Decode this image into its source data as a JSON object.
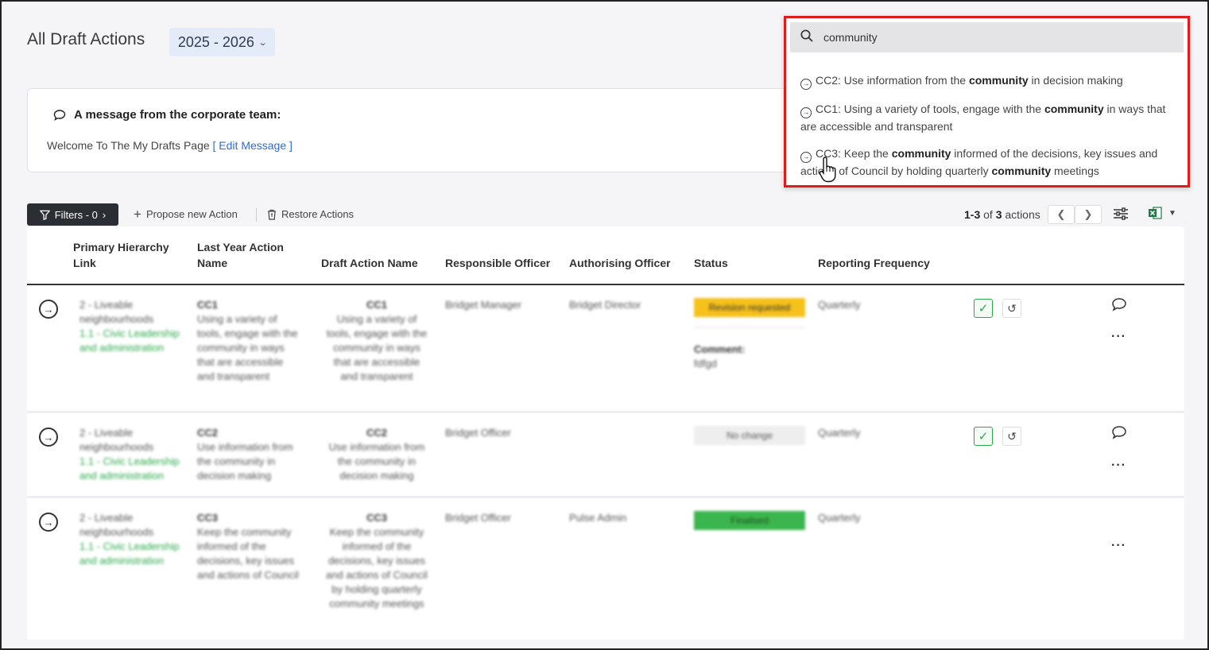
{
  "header": {
    "title": "All Draft Actions",
    "year": "2025 - 2026"
  },
  "message": {
    "title": "A message from the corporate team:",
    "body": "Welcome To The My Drafts Page",
    "edit_link": "[ Edit Message ]"
  },
  "toolbar": {
    "filters": "Filters - 0",
    "propose": "Propose new Action",
    "restore": "Restore Actions",
    "count_range": "1-3",
    "count_of": "of",
    "count_total": "3",
    "count_suffix": "actions"
  },
  "table": {
    "headers": {
      "primary": "Primary Hierarchy Link",
      "last_year": "Last Year Action Name",
      "draft": "Draft Action Name",
      "responsible": "Responsible Officer",
      "authorising": "Authorising Officer",
      "status": "Status",
      "frequency": "Reporting Frequency"
    },
    "rows": [
      {
        "hier1": "2 - Liveable neighbourhoods",
        "hier2": "1.1 - Civic Leadership and administration",
        "ly_code": "CC1",
        "ly_text": "Using a variety of tools, engage with the community in ways that are accessible and transparent",
        "d_code": "CC1",
        "d_text": "Using a variety of tools, engage with the community in ways that are accessible and transparent",
        "responsible": "Bridget Manager",
        "authorising": "Bridget Director",
        "status": "Revision requested",
        "comment_label": "Comment:",
        "comment": "fdfgd",
        "frequency": "Quarterly"
      },
      {
        "hier1": "2 - Liveable neighbourhoods",
        "hier2": "1.1 - Civic Leadership and administration",
        "ly_code": "CC2",
        "ly_text": "Use information from the community in decision making",
        "d_code": "CC2",
        "d_text": "Use information from the community in decision making",
        "responsible": "Bridget Officer",
        "authorising": "",
        "status": "No change",
        "frequency": "Quarterly"
      },
      {
        "hier1": "2 - Liveable neighbourhoods",
        "hier2": "1.1 - Civic Leadership and administration",
        "ly_code": "CC3",
        "ly_text": "Keep the community informed of the decisions, key issues and actions of Council",
        "d_code": "CC3",
        "d_text": "Keep the community informed of the decisions, key issues and actions of Council by holding quarterly community meetings",
        "responsible": "Bridget Officer",
        "authorising": "Pulse Admin",
        "status": "Finalised",
        "frequency": "Quarterly"
      }
    ]
  },
  "search": {
    "value": "community",
    "suggestions": [
      {
        "a": "CC2: Use information from the ",
        "b": "community",
        "c": " in decision making",
        "d": "",
        "e": ""
      },
      {
        "a": "CC1: Using a variety of tools, engage with the ",
        "b": "community",
        "c": " in ways that are accessible and transparent",
        "d": "",
        "e": ""
      },
      {
        "a": "CC3: Keep the ",
        "b": "community",
        "c": " informed of the decisions, key issues and actions of Council by holding quarterly ",
        "d": "community",
        "e": " meetings"
      }
    ]
  },
  "colors": {
    "accent": "#2c6cd6",
    "highlight_border": "#e01b1b",
    "status_yellow": "#f7c11b",
    "status_green": "#3bb64e",
    "approve_green": "#2aa84a"
  }
}
